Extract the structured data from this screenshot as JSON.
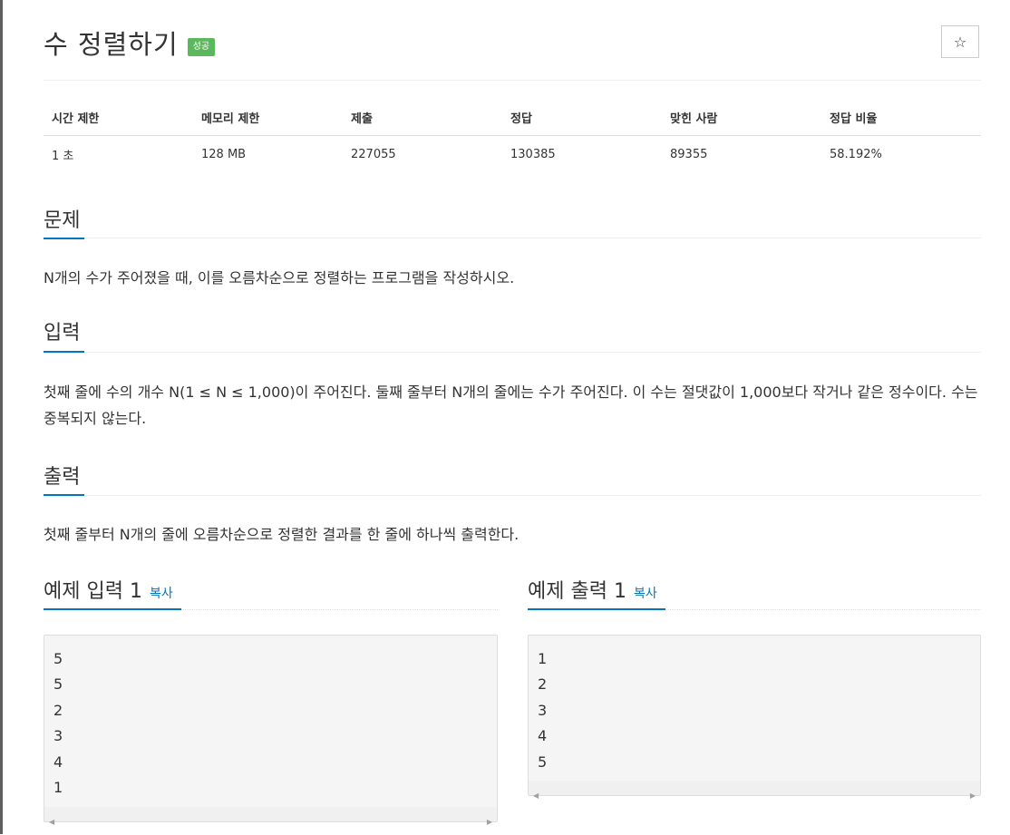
{
  "problem": {
    "title": "수 정렬하기",
    "badge": "성공",
    "star_icon": "☆"
  },
  "info_table": {
    "headers": [
      "시간 제한",
      "메모리 제한",
      "제출",
      "정답",
      "맞힌 사람",
      "정답 비율"
    ],
    "values": [
      "1 초",
      "128 MB",
      "227055",
      "130385",
      "89355",
      "58.192%"
    ]
  },
  "sections": {
    "problem": {
      "heading": "문제",
      "text": "N개의 수가 주어졌을 때, 이를 오름차순으로 정렬하는 프로그램을 작성하시오."
    },
    "input": {
      "heading": "입력",
      "text": "첫째 줄에 수의 개수 N(1 ≤ N ≤ 1,000)이 주어진다. 둘째 줄부터 N개의 줄에는 수가 주어진다. 이 수는 절댓값이 1,000보다 작거나 같은 정수이다. 수는 중복되지 않는다."
    },
    "output": {
      "heading": "출력",
      "text": "첫째 줄부터 N개의 줄에 오름차순으로 정렬한 결과를 한 줄에 하나씩 출력한다."
    }
  },
  "samples": {
    "input": {
      "heading": "예제 입력 1",
      "copy_label": "복사",
      "content": "5\n5\n2\n3\n4\n1"
    },
    "output": {
      "heading": "예제 출력 1",
      "copy_label": "복사",
      "content": "1\n2\n3\n4\n5"
    }
  },
  "colors": {
    "accent": "#0076c0",
    "success": "#5cb85c"
  }
}
